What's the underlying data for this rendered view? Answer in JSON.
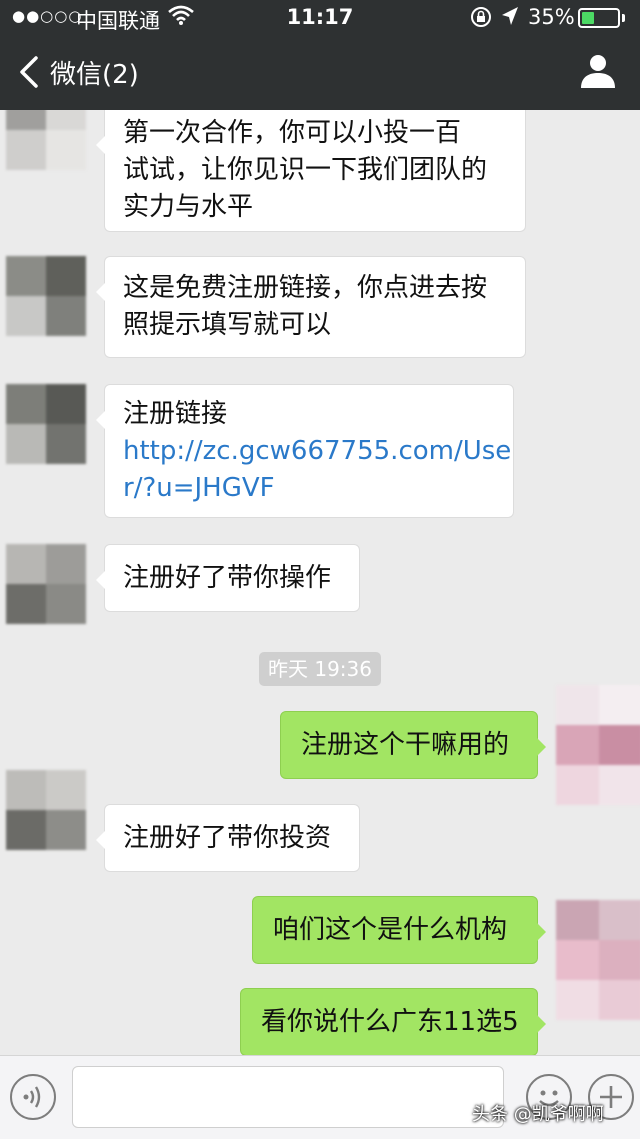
{
  "status_bar": {
    "signal": "●●○○○",
    "carrier": "中国联通",
    "time": "11:17",
    "battery": "35%",
    "battery_level": 0.35
  },
  "nav": {
    "back_label": "微信(2)"
  },
  "messages": [
    {
      "side": "left",
      "lines": [
        "第一次合作，你可以小投一百",
        "试试，让你见识一下我们团队的",
        "实力与水平"
      ]
    },
    {
      "side": "left",
      "lines": [
        "这是免费注册链接，你点进去按",
        "照提示填写就可以"
      ]
    },
    {
      "side": "left",
      "lines": [
        "注册链接"
      ],
      "link_lines": [
        "http://zc.gcw667755.com/Use",
        "r/?u=JHGVF"
      ]
    },
    {
      "side": "left",
      "lines": [
        "注册好了带你操作"
      ]
    },
    {
      "side": "right",
      "lines": [
        "注册这个干嘛用的"
      ]
    },
    {
      "side": "left",
      "lines": [
        "注册好了带你投资"
      ]
    },
    {
      "side": "right",
      "lines": [
        "咱们这个是什么机构"
      ]
    },
    {
      "side": "right",
      "lines": [
        "看你说什么广东11选5"
      ]
    }
  ],
  "time_separator": "昨天 19:36",
  "watermark": "头条 @凯爷啊啊",
  "colors": {
    "header_bg": "#2e3132",
    "chat_bg": "#ebebeb",
    "outgoing_bubble": "#a2e563",
    "incoming_bubble": "#ffffff",
    "link": "#2a79c9"
  }
}
